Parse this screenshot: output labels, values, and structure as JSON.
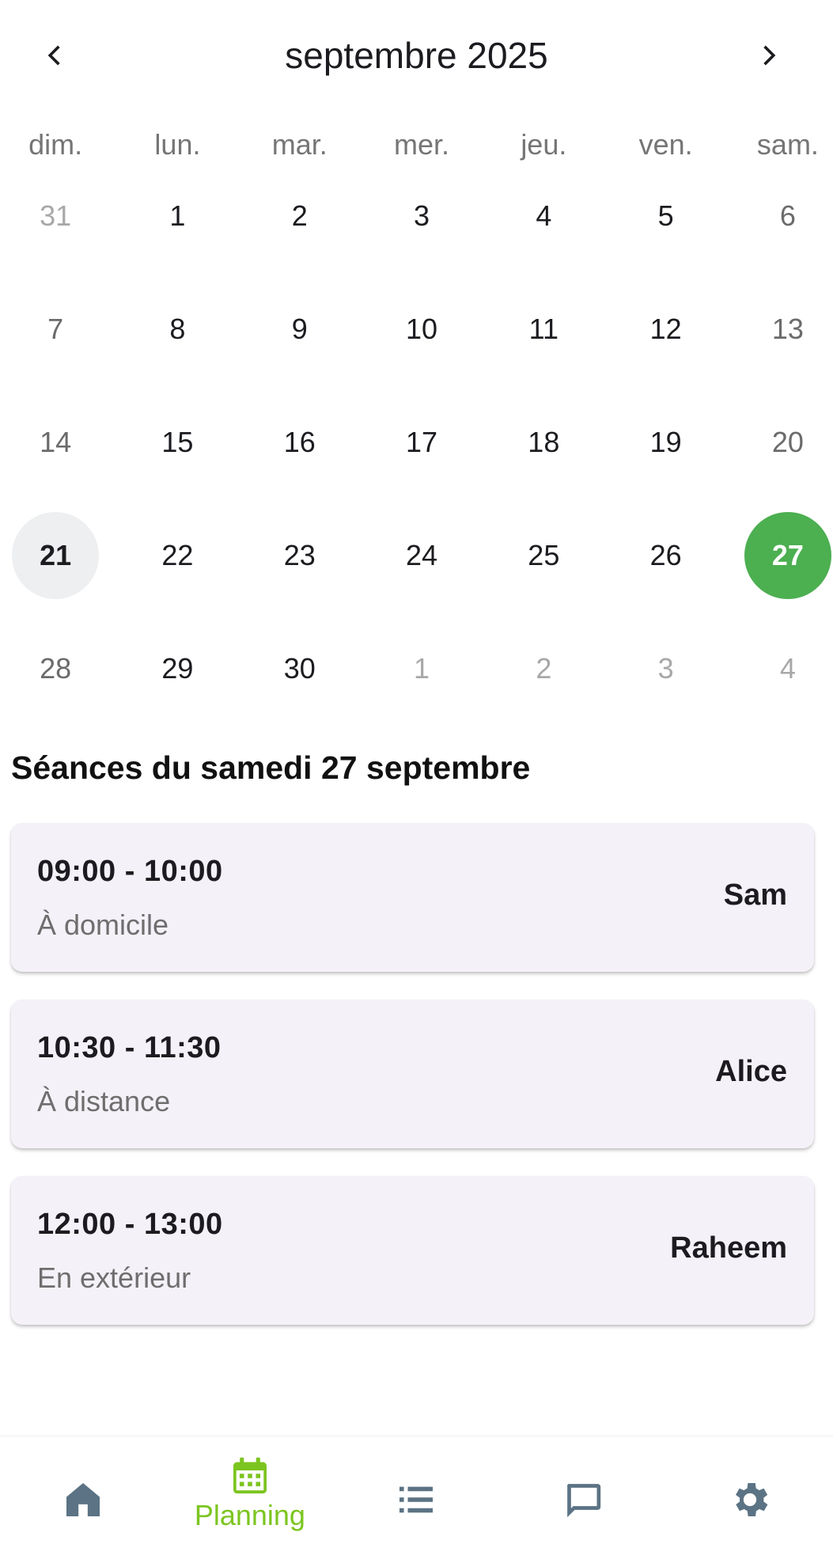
{
  "header": {
    "month_title": "septembre 2025",
    "prev_icon": "chevron-left-icon",
    "next_icon": "chevron-right-icon"
  },
  "weekdays": [
    "dim.",
    "lun.",
    "mar.",
    "mer.",
    "jeu.",
    "ven.",
    "sam."
  ],
  "calendar": {
    "weeks": [
      [
        "31",
        "1",
        "2",
        "3",
        "4",
        "5",
        "6"
      ],
      [
        "7",
        "8",
        "9",
        "10",
        "11",
        "12",
        "13"
      ],
      [
        "14",
        "15",
        "16",
        "17",
        "18",
        "19",
        "20"
      ],
      [
        "21",
        "22",
        "23",
        "24",
        "25",
        "26",
        "27"
      ],
      [
        "28",
        "29",
        "30",
        "1",
        "2",
        "3",
        "4"
      ]
    ],
    "today": "21",
    "selected": "27",
    "selected_color": "#4caf50"
  },
  "sessions_title": "Séances du samedi 27 septembre",
  "sessions": [
    {
      "time": "09:00 - 10:00",
      "location": "À domicile",
      "client": "Sam"
    },
    {
      "time": "10:30 - 11:30",
      "location": "À distance",
      "client": "Alice"
    },
    {
      "time": "12:00 - 13:00",
      "location": "En extérieur",
      "client": "Raheem"
    }
  ],
  "bottom_nav": [
    {
      "icon": "home-icon",
      "label": ""
    },
    {
      "icon": "calendar-icon",
      "label": "Planning",
      "active": true
    },
    {
      "icon": "list-icon",
      "label": ""
    },
    {
      "icon": "chat-icon",
      "label": ""
    },
    {
      "icon": "settings-icon",
      "label": ""
    }
  ],
  "colors": {
    "accent": "#7cc520",
    "nav_icon": "#5b7384",
    "card_bg": "#f4f1f8"
  }
}
